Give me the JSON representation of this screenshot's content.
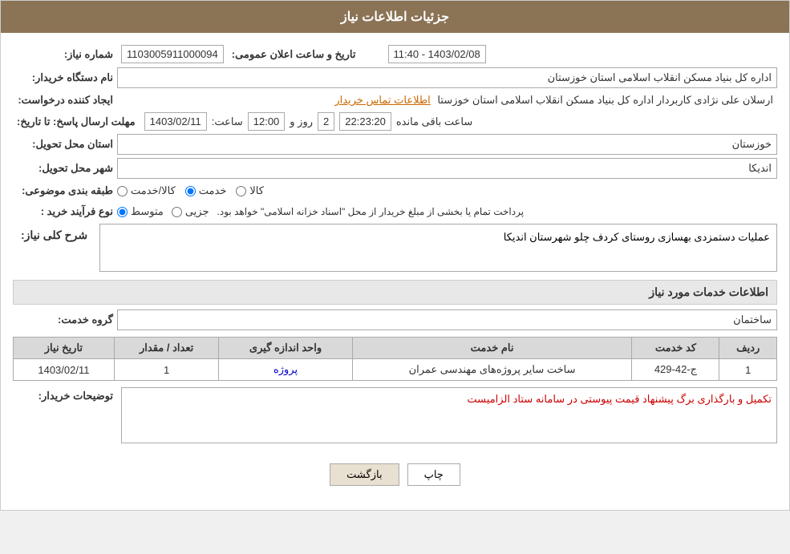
{
  "header": {
    "title": "جزئیات اطلاعات نیاز"
  },
  "fields": {
    "need_number_label": "شماره نیاز:",
    "need_number_value": "1103005911000094",
    "announce_label": "تاریخ و ساعت اعلان عمومی:",
    "announce_value": "1403/02/08 - 11:40",
    "buyer_name_label": "نام دستگاه خریدار:",
    "buyer_name_value": "اداره کل بنیاد مسکن انقلاب اسلامی استان خوزستان",
    "creator_label": "ایجاد کننده درخواست:",
    "creator_value": "ارسلان علی نژادی کاربردار اداره کل بنیاد مسکن انقلاب اسلامی استان خوزستا",
    "creator_link": "اطلاعات تماس خریدار",
    "deadline_label": "مهلت ارسال پاسخ: تا تاریخ:",
    "deadline_date": "1403/02/11",
    "deadline_time_label": "ساعت:",
    "deadline_time": "12:00",
    "deadline_days_label": "روز و",
    "deadline_days": "2",
    "deadline_remaining_label": "ساعت باقی مانده",
    "deadline_remaining": "22:23:20",
    "province_label": "استان محل تحویل:",
    "province_value": "خوزستان",
    "city_label": "شهر محل تحویل:",
    "city_value": "اندیکا",
    "category_label": "طبقه بندی موضوعی:",
    "category_options": [
      "کالا",
      "خدمت",
      "کالا/خدمت"
    ],
    "category_selected": "خدمت",
    "process_label": "نوع فرآیند خرید :",
    "process_options": [
      "جزیی",
      "متوسط"
    ],
    "process_note": "پرداخت تمام یا بخشی از مبلغ خریدار از محل \"اسناد خزانه اسلامی\" خواهد بود.",
    "description_label": "شرح کلی نیاز:",
    "description_value": "عملیات دستمزدی بهسازی روستای کردف چلو شهرستان اندیکا",
    "services_label": "اطلاعات خدمات مورد نیاز",
    "service_group_label": "گروه خدمت:",
    "service_group_value": "ساختمان",
    "table": {
      "columns": [
        "ردیف",
        "کد خدمت",
        "نام خدمت",
        "واحد اندازه گیری",
        "تعداد / مقدار",
        "تاریخ نیاز"
      ],
      "rows": [
        {
          "row_num": "1",
          "service_code": "ج-42-429",
          "service_name": "ساخت سایر پروژه‌های مهندسی عمران",
          "unit": "پروژه",
          "quantity": "1",
          "date": "1403/02/11"
        }
      ]
    },
    "buyer_desc_label": "توضیحات خریدار:",
    "buyer_desc_value": "تکمیل و بارگذاری برگ پیشنهاد قیمت پیوستی در سامانه ستاد الزامیست",
    "btn_print": "چاپ",
    "btn_back": "بازگشت"
  }
}
